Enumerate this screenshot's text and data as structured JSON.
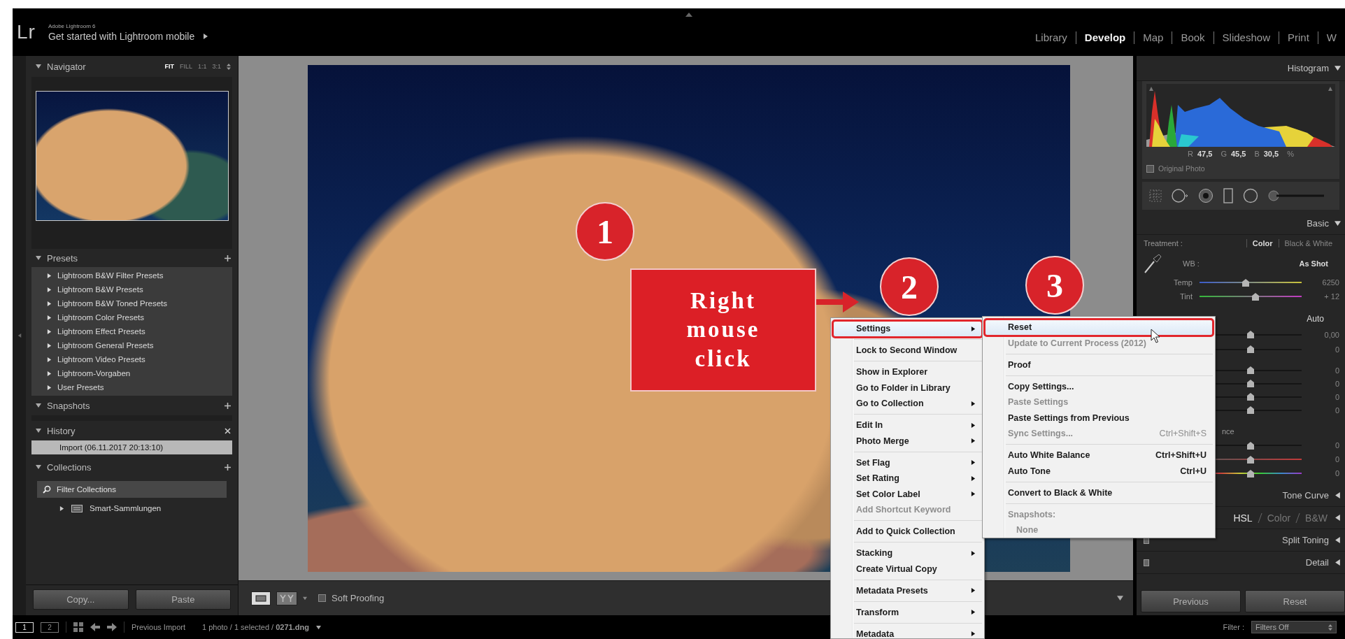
{
  "header": {
    "logo": "Lr",
    "product": "Adobe Lightroom 6",
    "promo": "Get started with Lightroom mobile",
    "modules": [
      {
        "label": "Library",
        "selected": false
      },
      {
        "label": "Develop",
        "selected": true
      },
      {
        "label": "Map",
        "selected": false
      },
      {
        "label": "Book",
        "selected": false
      },
      {
        "label": "Slideshow",
        "selected": false
      },
      {
        "label": "Print",
        "selected": false
      },
      {
        "label": "W",
        "selected": false
      }
    ]
  },
  "left_panel": {
    "navigator": {
      "title": "Navigator",
      "zoom_options": [
        {
          "label": "FIT",
          "selected": true
        },
        {
          "label": "FILL",
          "selected": false
        },
        {
          "label": "1:1",
          "selected": false
        },
        {
          "label": "3:1",
          "selected": false
        }
      ]
    },
    "presets": {
      "title": "Presets",
      "items": [
        "Lightroom B&W Filter Presets",
        "Lightroom B&W Presets",
        "Lightroom B&W Toned Presets",
        "Lightroom Color Presets",
        "Lightroom Effect Presets",
        "Lightroom General Presets",
        "Lightroom Video Presets",
        "Lightroom-Vorgaben",
        "User Presets"
      ]
    },
    "snapshots": {
      "title": "Snapshots"
    },
    "history": {
      "title": "History",
      "items": [
        {
          "label": "Import (06.11.2017 20:13:10)",
          "selected": true
        }
      ]
    },
    "collections": {
      "title": "Collections",
      "search": {
        "placeholder": "Filter Collections"
      },
      "items": [
        {
          "label": "Smart-Sammlungen",
          "expanded": false
        }
      ]
    },
    "buttons": [
      "Copy...",
      "Paste"
    ]
  },
  "center_toolbar": {
    "soft_proofing": {
      "label": "Soft Proofing",
      "checked": false
    }
  },
  "right_panel": {
    "histogram": {
      "title": "Histogram",
      "readout": [
        {
          "channel": "R",
          "value": "47,5"
        },
        {
          "channel": "G",
          "value": "45,5"
        },
        {
          "channel": "B",
          "value": "30,5"
        }
      ],
      "unit": "%",
      "original_photo": {
        "label": "Original Photo",
        "checked": false
      }
    },
    "basic": {
      "title": "Basic",
      "treatment_label": "Treatment :",
      "treatments": [
        {
          "label": "Color",
          "selected": true
        },
        {
          "label": "Black & White",
          "selected": false
        }
      ],
      "wb_label": "WB :",
      "wb_value": "As Shot",
      "wb_sliders": [
        {
          "label": "Temp",
          "kind": "temp",
          "level": 0.45,
          "value": "6250"
        },
        {
          "label": "Tint",
          "kind": "tint",
          "level": 0.55,
          "value": "+ 12"
        }
      ],
      "auto": "Auto",
      "tone_groups": [
        [
          {
            "kind": "plain",
            "level": 0.5,
            "value": "0,00"
          },
          {
            "kind": "plain",
            "level": 0.5,
            "value": "0"
          }
        ],
        [
          {
            "kind": "plain",
            "level": 0.5,
            "value": "0"
          },
          {
            "kind": "plain",
            "level": 0.5,
            "value": "0"
          },
          {
            "kind": "plain",
            "level": 0.5,
            "value": "0"
          },
          {
            "kind": "plain",
            "level": 0.5,
            "value": "0"
          }
        ]
      ],
      "presence_label": "nce",
      "presence_sliders": [
        {
          "kind": "plain",
          "level": 0.5,
          "value": "0"
        },
        {
          "kind": "vibrance",
          "level": 0.5,
          "value": "0"
        },
        {
          "kind": "saturation",
          "level": 0.5,
          "value": "0"
        }
      ]
    },
    "panels": [
      {
        "kind": "plain",
        "title": "Tone Curve"
      },
      {
        "kind": "tabs",
        "tabs": [
          {
            "label": "HSL",
            "selected": true
          },
          {
            "label": "Color",
            "selected": false
          },
          {
            "label": "B&W",
            "selected": false
          }
        ]
      },
      {
        "kind": "switch",
        "title": "Split Toning"
      },
      {
        "kind": "switch",
        "title": "Detail"
      }
    ],
    "buttons": [
      "Previous",
      "Reset"
    ]
  },
  "bottom_bar": {
    "views": [
      {
        "label": "1",
        "selected": true
      },
      {
        "label": "2",
        "selected": false
      }
    ],
    "source": "Previous Import",
    "info": "1 photo / 1 selected / **0271.dng**",
    "filter_label": "Filter :",
    "filter_value": "Filters Off"
  },
  "context_menu": {
    "groups": [
      [
        {
          "label": "Settings",
          "kind": "item",
          "has_submenu": true,
          "disabled": false,
          "highlighted": true,
          "annotated": true
        }
      ],
      [
        {
          "label": "Lock to Second Window",
          "kind": "item",
          "has_submenu": false,
          "disabled": false,
          "highlighted": false,
          "annotated": false
        }
      ],
      [
        {
          "label": "Show in Explorer",
          "kind": "item",
          "has_submenu": false,
          "disabled": false,
          "highlighted": false,
          "annotated": false
        },
        {
          "label": "Go to Folder in Library",
          "kind": "item",
          "has_submenu": false,
          "disabled": false,
          "highlighted": false,
          "annotated": false
        },
        {
          "label": "Go to Collection",
          "kind": "item",
          "has_submenu": true,
          "disabled": false,
          "highlighted": false,
          "annotated": false
        }
      ],
      [
        {
          "label": "Edit In",
          "kind": "item",
          "has_submenu": true,
          "disabled": false,
          "highlighted": false,
          "annotated": false
        },
        {
          "label": "Photo Merge",
          "kind": "item",
          "has_submenu": true,
          "disabled": false,
          "highlighted": false,
          "annotated": false
        }
      ],
      [
        {
          "label": "Set Flag",
          "kind": "item",
          "has_submenu": true,
          "disabled": false,
          "highlighted": false,
          "annotated": false
        },
        {
          "label": "Set Rating",
          "kind": "item",
          "has_submenu": true,
          "disabled": false,
          "highlighted": false,
          "annotated": false
        },
        {
          "label": "Set Color Label",
          "kind": "item",
          "has_submenu": true,
          "disabled": false,
          "highlighted": false,
          "annotated": false
        },
        {
          "label": "Add Shortcut Keyword",
          "kind": "item",
          "has_submenu": false,
          "disabled": true,
          "highlighted": false,
          "annotated": false
        }
      ],
      [
        {
          "label": "Add to Quick Collection",
          "kind": "item",
          "has_submenu": false,
          "disabled": false,
          "highlighted": false,
          "annotated": false
        }
      ],
      [
        {
          "label": "Stacking",
          "kind": "item",
          "has_submenu": true,
          "disabled": false,
          "highlighted": false,
          "annotated": false
        },
        {
          "label": "Create Virtual Copy",
          "kind": "item",
          "has_submenu": false,
          "disabled": false,
          "highlighted": false,
          "annotated": false
        }
      ],
      [
        {
          "label": "Metadata Presets",
          "kind": "item",
          "has_submenu": true,
          "disabled": false,
          "highlighted": false,
          "annotated": false
        }
      ],
      [
        {
          "label": "Transform",
          "kind": "item",
          "has_submenu": true,
          "disabled": false,
          "highlighted": false,
          "annotated": false
        }
      ],
      [
        {
          "label": "Metadata",
          "kind": "item",
          "has_submenu": true,
          "disabled": false,
          "highlighted": false,
          "annotated": false
        }
      ]
    ]
  },
  "settings_submenu": {
    "groups": [
      [
        {
          "label": "Reset",
          "kind": "item",
          "has_submenu": false,
          "disabled": false,
          "highlighted": true,
          "annotated": true
        },
        {
          "label": "Update to Current Process (2012)",
          "kind": "item",
          "has_submenu": false,
          "disabled": true,
          "highlighted": false,
          "annotated": false
        }
      ],
      [
        {
          "label": "Proof",
          "kind": "item",
          "has_submenu": false,
          "disabled": false,
          "highlighted": false,
          "annotated": false
        }
      ],
      [
        {
          "label": "Copy Settings...",
          "kind": "item",
          "has_submenu": false,
          "disabled": false,
          "highlighted": false,
          "annotated": false
        },
        {
          "label": "Paste Settings",
          "kind": "item",
          "has_submenu": false,
          "disabled": true,
          "highlighted": false,
          "annotated": false
        },
        {
          "label": "Paste Settings from Previous",
          "kind": "item",
          "has_submenu": false,
          "disabled": false,
          "highlighted": false,
          "annotated": false
        },
        {
          "label": "Sync Settings...",
          "kind": "item",
          "has_submenu": false,
          "disabled": true,
          "highlighted": false,
          "annotated": false,
          "shortcut": "Ctrl+Shift+S"
        }
      ],
      [
        {
          "label": "Auto White Balance",
          "kind": "item",
          "has_submenu": false,
          "disabled": false,
          "highlighted": false,
          "annotated": false,
          "shortcut": "Ctrl+Shift+U"
        },
        {
          "label": "Auto Tone",
          "kind": "item",
          "has_submenu": false,
          "disabled": false,
          "highlighted": false,
          "annotated": false,
          "shortcut": "Ctrl+U"
        }
      ],
      [
        {
          "label": "Convert to Black & White",
          "kind": "item",
          "has_submenu": false,
          "disabled": false,
          "highlighted": false,
          "annotated": false
        }
      ],
      [
        {
          "label": "Snapshots:",
          "kind": "item",
          "has_submenu": false,
          "disabled": true,
          "highlighted": false,
          "annotated": false
        },
        {
          "label": "None",
          "kind": "indented",
          "has_submenu": false,
          "disabled": true,
          "highlighted": false,
          "annotated": false
        }
      ]
    ]
  },
  "annotations": {
    "steps": [
      "1",
      "2",
      "3"
    ],
    "callout": "Right mouse click"
  }
}
